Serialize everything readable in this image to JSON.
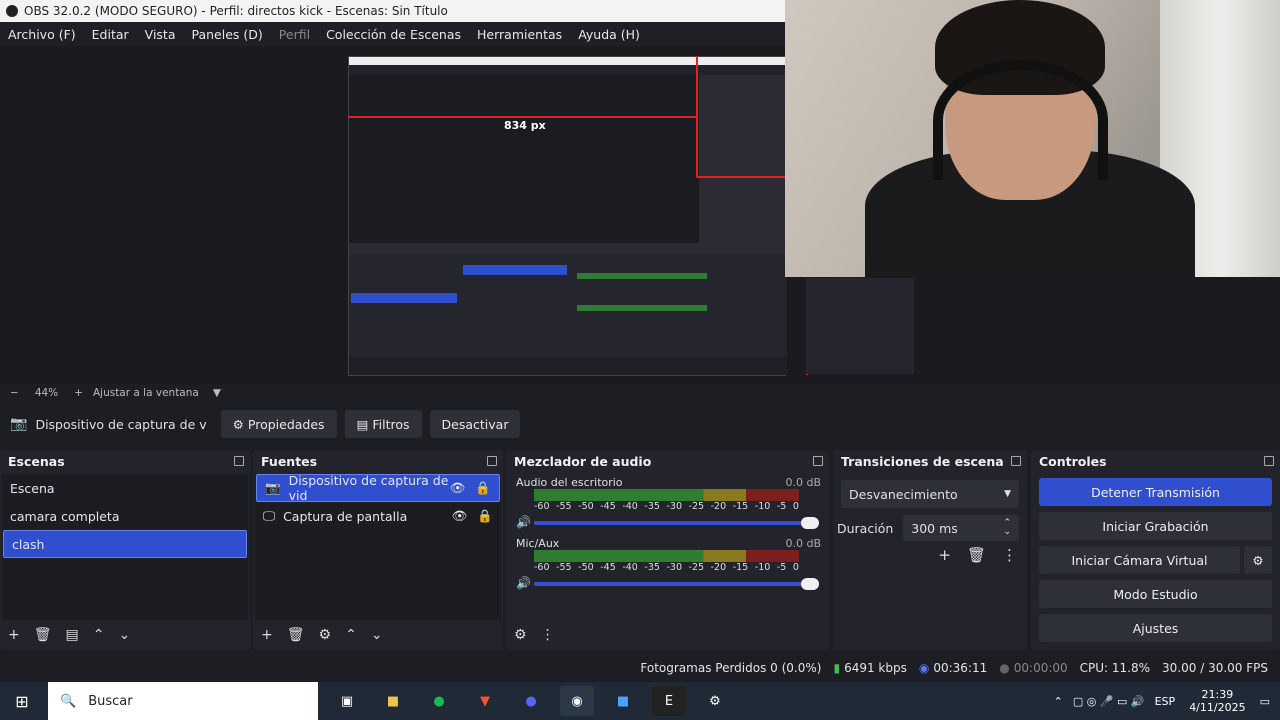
{
  "window": {
    "title": "OBS 32.0.2 (MODO SEGURO) - Perfil: directos kick - Escenas: Sin Título"
  },
  "menu": {
    "items": [
      "Archivo (F)",
      "Editar",
      "Vista",
      "Paneles (D)",
      "Perfil",
      "Colección de Escenas",
      "Herramientas",
      "Ayuda (H)"
    ]
  },
  "preview": {
    "nested_label": "834 px",
    "zoom": "44%",
    "fit_label": "Ajustar a la ventana"
  },
  "source_bar": {
    "source": "Dispositivo de captura de v",
    "properties": "Propiedades",
    "filters": "Filtros",
    "deactivate": "Desactivar"
  },
  "scenes": {
    "title": "Escenas",
    "items": [
      "Escena",
      "camara completa",
      "clash"
    ],
    "selected": 2
  },
  "sources": {
    "title": "Fuentes",
    "items": [
      "Dispositivo de captura de vid",
      "Captura de pantalla"
    ],
    "selected": 0
  },
  "mixer": {
    "title": "Mezclador de audio",
    "channels": [
      {
        "name": "Audio del escritorio",
        "db": "0.0 dB"
      },
      {
        "name": "Mic/Aux",
        "db": "0.0 dB"
      }
    ],
    "ticks": [
      "-60",
      "-55",
      "-50",
      "-45",
      "-40",
      "-35",
      "-30",
      "-25",
      "-20",
      "-15",
      "-10",
      "-5",
      "0"
    ]
  },
  "transitions": {
    "title": "Transiciones de escena",
    "selected": "Desvanecimiento",
    "duration_label": "Duración",
    "duration_value": "300 ms"
  },
  "controls": {
    "title": "Controles",
    "stop_stream": "Detener Transmisión",
    "start_record": "Iniciar Grabación",
    "virtual_cam": "Iniciar Cámara Virtual",
    "studio": "Modo Estudio",
    "settings": "Ajustes"
  },
  "status": {
    "dropped": "Fotogramas Perdidos 0 (0.0%)",
    "kbps": "6491 kbps",
    "stream_time": "00:36:11",
    "rec_time": "00:00:00",
    "cpu": "CPU: 11.8%",
    "fps": "30.00 / 30.00 FPS"
  },
  "taskbar": {
    "search": "Buscar",
    "lang": "ESP",
    "time": "21:39",
    "date": "4/11/2025"
  },
  "colors": {
    "accent": "#2f4fcf",
    "panel": "#23242b",
    "bg": "#1d1e24"
  }
}
